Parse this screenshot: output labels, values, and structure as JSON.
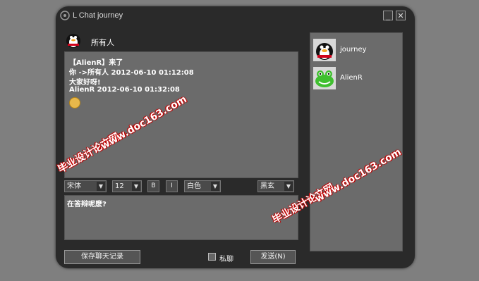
{
  "window": {
    "title": "L Chat journey",
    "minimize_label": "_",
    "close_label": "✕"
  },
  "chat": {
    "target": "所有人",
    "messages": [
      "【AlienR】来了",
      "你 ->所有人 2012-06-10 01:12:08",
      "大家好呀!",
      "AlienR 2012-06-10 01:32:08"
    ]
  },
  "toolbar": {
    "font_family": "宋体",
    "font_size": "12",
    "bold_label": "B",
    "italic_label": "I",
    "color": "白色",
    "style": "黑玄"
  },
  "input": {
    "value": "在答辩呢麽?"
  },
  "buttons": {
    "save_label": "保存聊天记录",
    "private_label": "私聊",
    "send_label": "发送(N)"
  },
  "users": [
    {
      "name": "journey",
      "avatar": "penguin-avatar"
    },
    {
      "name": "AlienR",
      "avatar": "frog-avatar"
    }
  ],
  "watermark": {
    "cn": "毕业设计论文网",
    "url": "www.doc163.com"
  },
  "colors": {
    "window_bg": "#2a2a2a",
    "panel_bg": "#6b6b6b",
    "watermark_red": "#c00000"
  }
}
